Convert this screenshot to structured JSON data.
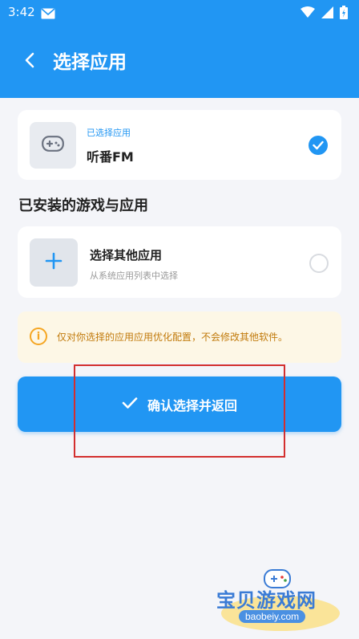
{
  "status_bar": {
    "time": "3:42"
  },
  "header": {
    "title": "选择应用"
  },
  "selected": {
    "label": "已选择应用",
    "name": "听番FM",
    "checked": true
  },
  "section": {
    "title": "已安装的游戏与应用"
  },
  "other_app": {
    "title": "选择其他应用",
    "subtitle": "从系统应用列表中选择",
    "selected": false
  },
  "notice": {
    "icon_text": "i",
    "text": "仅对你选择的应用应用优化配置，不会修改其他软件。"
  },
  "confirm": {
    "label": "确认选择并返回"
  },
  "watermark": {
    "cn": "宝贝游戏网",
    "en": "baobeiy.com"
  },
  "colors": {
    "primary": "#2196f3",
    "notice_bg": "#fdf7e6",
    "notice_fg": "#c17a0b",
    "highlight": "#d32f2f"
  },
  "icons": [
    "mail-icon",
    "wifi-icon",
    "signal-icon",
    "battery-icon",
    "back-arrow-icon",
    "gamepad-icon",
    "checkmark-icon",
    "plus-icon",
    "info-icon"
  ]
}
